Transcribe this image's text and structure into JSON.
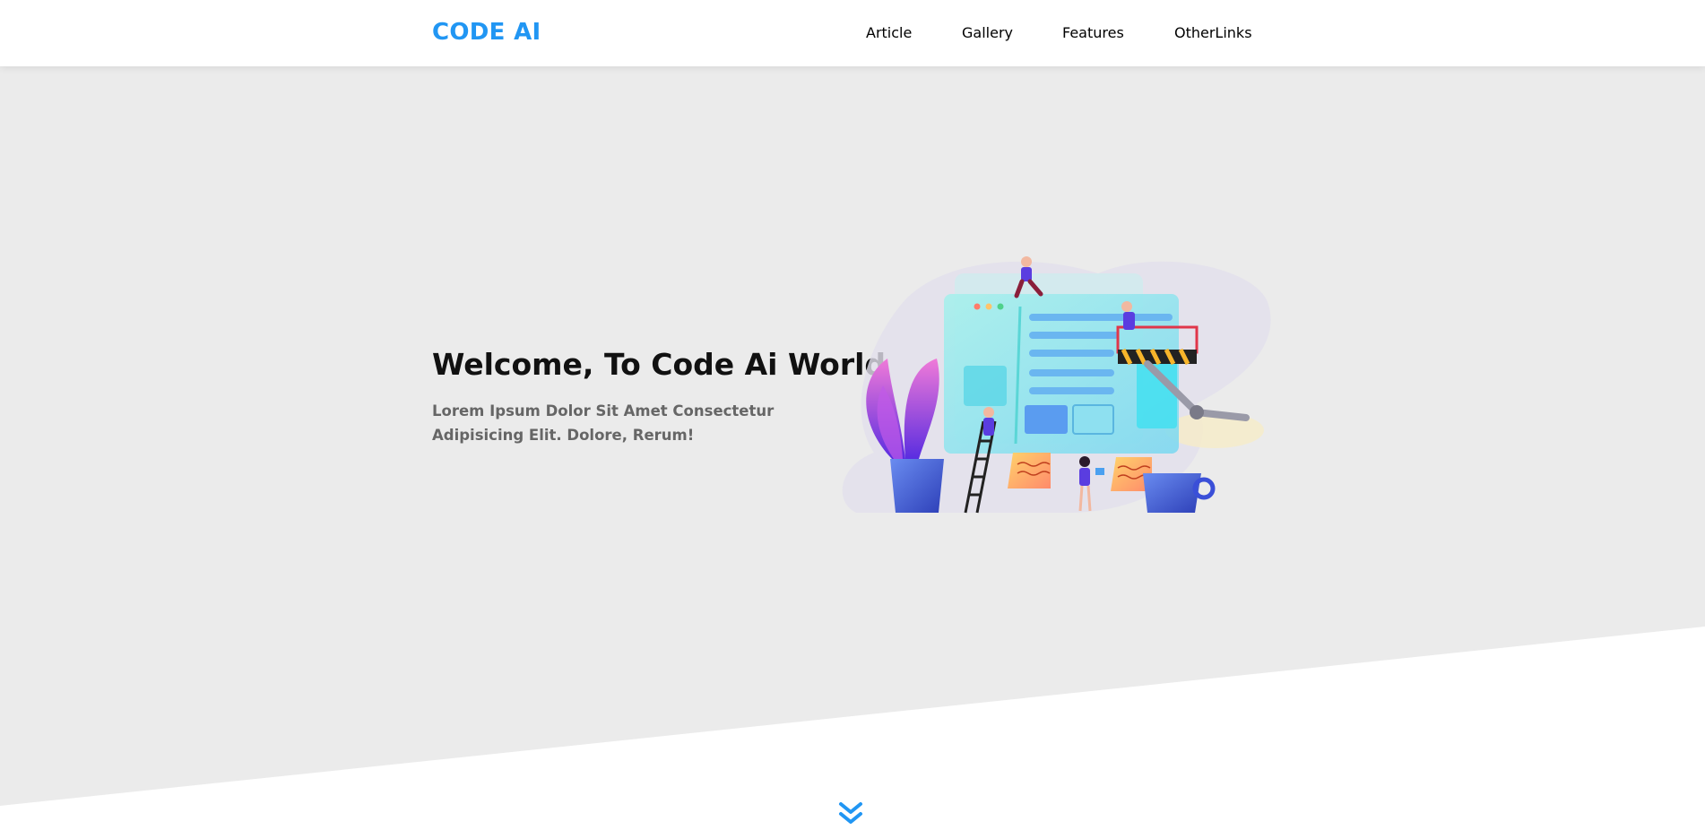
{
  "brand": {
    "name": "CODE AI",
    "accent_color": "#2196f3"
  },
  "nav": {
    "items": [
      {
        "label": "Article"
      },
      {
        "label": "Gallery"
      },
      {
        "label": "Features"
      },
      {
        "label": "OtherLinks"
      }
    ]
  },
  "hero": {
    "title": "Welcome, To Code Ai World",
    "subtitle": "Lorem Ipsum Dolor Sit Amet Consectetur Adipisicing Elit. Dolore, Rerum!",
    "background_color": "#ebebeb",
    "illustration": "team-building-website-illustration"
  },
  "scroll": {
    "icon": "double-chevron-down-icon"
  }
}
